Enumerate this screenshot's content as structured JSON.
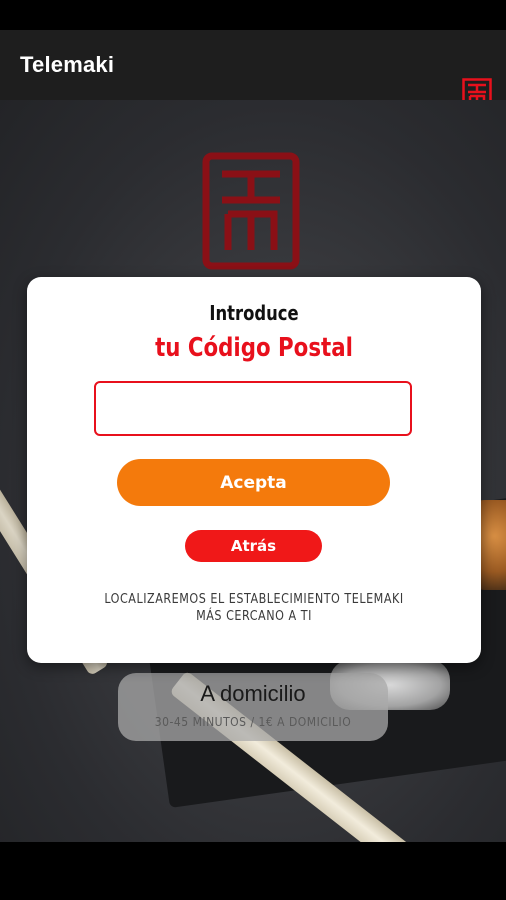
{
  "app_bar": {
    "title": "Telemaki",
    "logo_icon": "telemaki-logo-icon"
  },
  "delivery_card": {
    "title": "A domicilio",
    "subtitle": "30-45 MINUTOS / 1€ A DOMICILIO"
  },
  "dialog": {
    "heading": "Introduce",
    "title": "tu Código Postal",
    "postal_code": {
      "value": "",
      "placeholder": ""
    },
    "accept_label": "Acepta",
    "back_label": "Atrás",
    "note_line1": "LOCALIZAREMOS EL ESTABLECIMIENTO TELEMAKI",
    "note_line2": "MÁS CERCANO A TI"
  },
  "colors": {
    "brand_red": "#e8101c",
    "accept_orange": "#f47a0c",
    "back_red": "#f01818",
    "app_bar": "#1e1e1e"
  }
}
